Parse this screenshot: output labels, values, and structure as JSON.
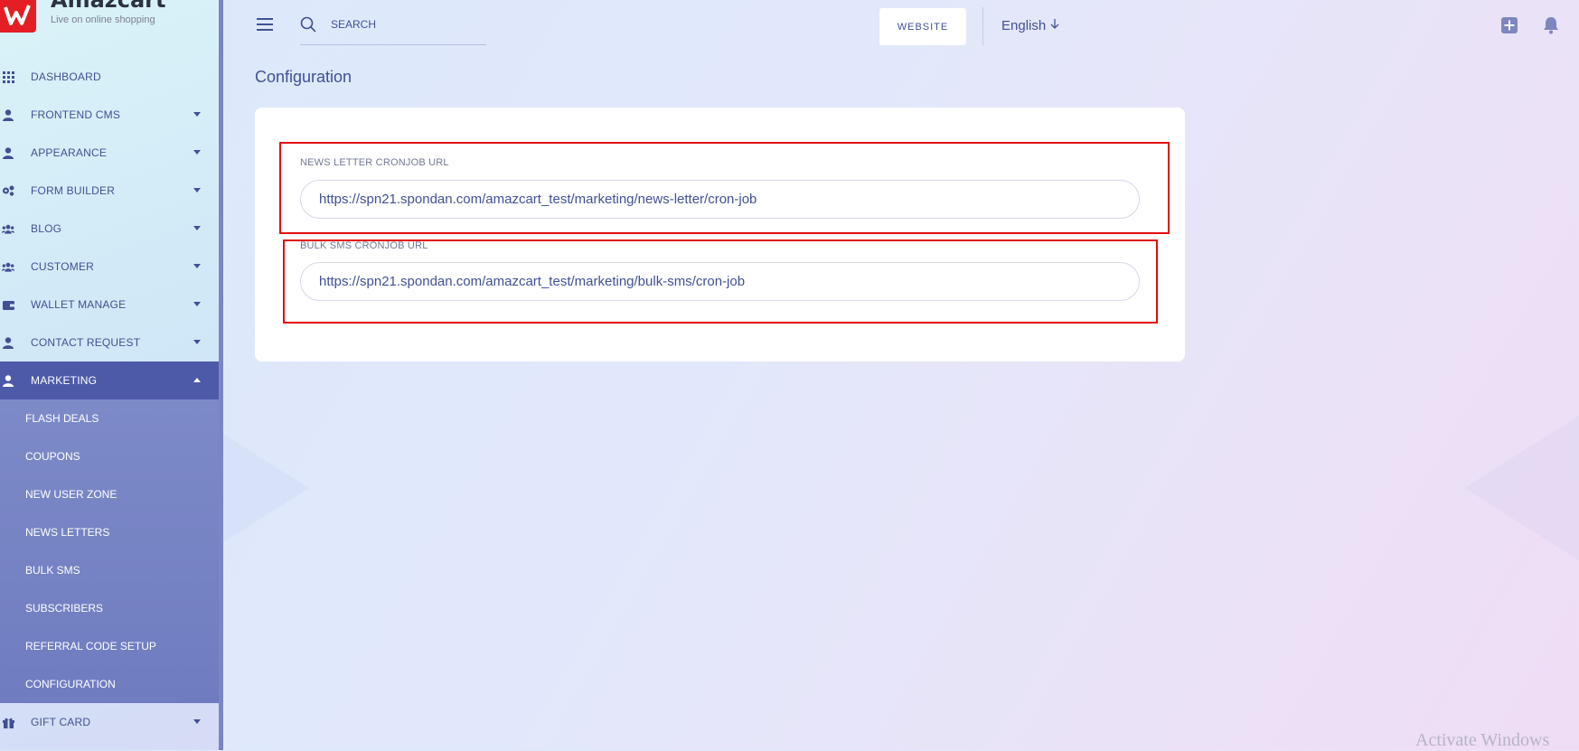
{
  "brand": {
    "name": "Amazcart",
    "tagline": "Live on online shopping"
  },
  "sidebar": {
    "items": [
      {
        "label": "DASHBOARD",
        "icon": "grid-icon"
      },
      {
        "label": "FRONTEND CMS",
        "icon": "user-icon"
      },
      {
        "label": "APPEARANCE",
        "icon": "user-icon"
      },
      {
        "label": "FORM BUILDER",
        "icon": "cogs-icon"
      },
      {
        "label": "BLOG",
        "icon": "users-icon"
      },
      {
        "label": "CUSTOMER",
        "icon": "users-icon"
      },
      {
        "label": "WALLET MANAGE",
        "icon": "wallet-icon"
      },
      {
        "label": "CONTACT REQUEST",
        "icon": "user-icon"
      },
      {
        "label": "MARKETING",
        "icon": "user-icon",
        "active": true
      }
    ],
    "submenu": [
      "FLASH DEALS",
      "COUPONS",
      "NEW USER ZONE",
      "NEWS LETTERS",
      "BULK SMS",
      "SUBSCRIBERS",
      "REFERRAL CODE SETUP",
      "CONFIGURATION"
    ],
    "after": {
      "label": "GIFT CARD",
      "icon": "gift-icon"
    }
  },
  "topbar": {
    "search_placeholder": "SEARCH",
    "website_label": "WEBSITE",
    "language": "English"
  },
  "page": {
    "title": "Configuration",
    "fields": [
      {
        "label": "NEWS LETTER CRONJOB URL",
        "value": "https://spn21.spondan.com/amazcart_test/marketing/news-letter/cron-job"
      },
      {
        "label": "BULK SMS CRONJOB URL",
        "value": "https://spn21.spondan.com/amazcart_test/marketing/bulk-sms/cron-job"
      }
    ]
  },
  "colors": {
    "primary": "#415094",
    "active_nav": "#4d5aa8",
    "highlight": "#e20b0b",
    "brand_red": "#e31e24"
  },
  "watermark": "Activate Windows"
}
